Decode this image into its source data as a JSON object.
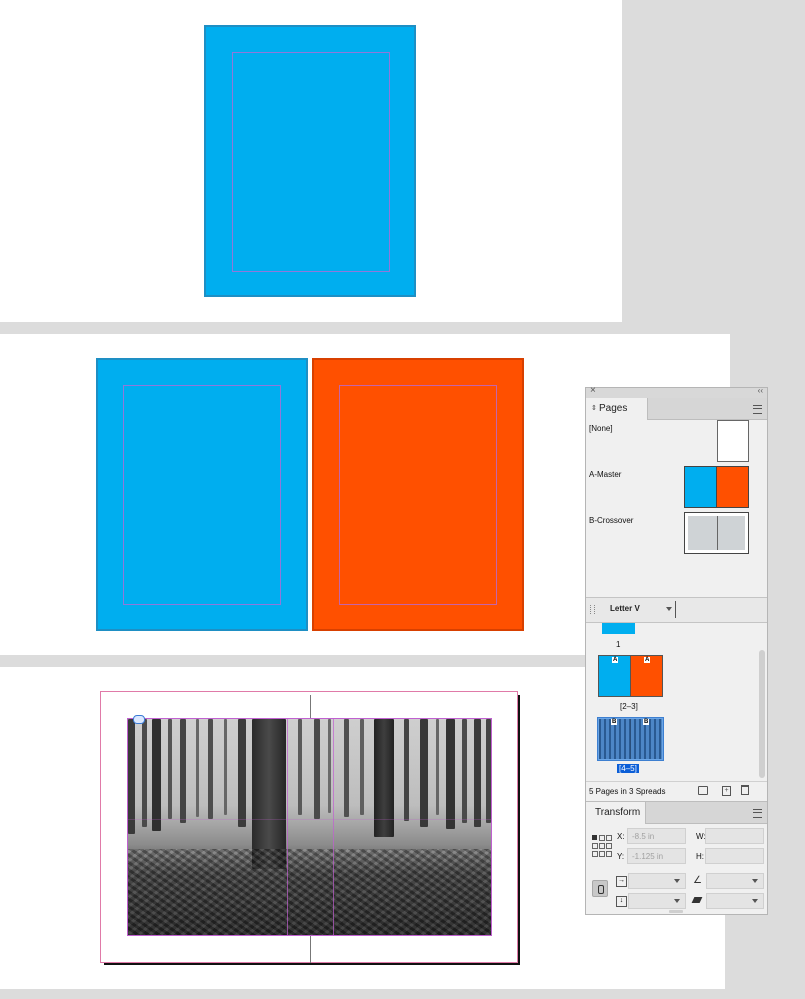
{
  "colors": {
    "cyan": "#00aeef",
    "orange": "#ff5000",
    "margin": "#b46ad6",
    "selection": "#0b5ed7"
  },
  "pages_panel": {
    "close_glyph": "×",
    "collapse_glyph": "‹‹",
    "tab_label": "Pages",
    "masters": [
      {
        "label": "[None]"
      },
      {
        "label": "A-Master"
      },
      {
        "label": "B-Crossover"
      }
    ],
    "page_size": "Letter V",
    "page_thumbs": [
      {
        "label": "1"
      },
      {
        "label": "[2–3]",
        "prefix_left": "A",
        "prefix_right": "A"
      },
      {
        "label": "[4–5]",
        "prefix_left": "B",
        "prefix_right": "B"
      }
    ],
    "status": "5 Pages in 3 Spreads"
  },
  "transform_panel": {
    "tab_label": "Transform",
    "x_label": "X:",
    "x_value": "-8.5 in",
    "y_label": "Y:",
    "y_value": "-1.125 in",
    "w_label": "W:",
    "h_label": "H:"
  }
}
